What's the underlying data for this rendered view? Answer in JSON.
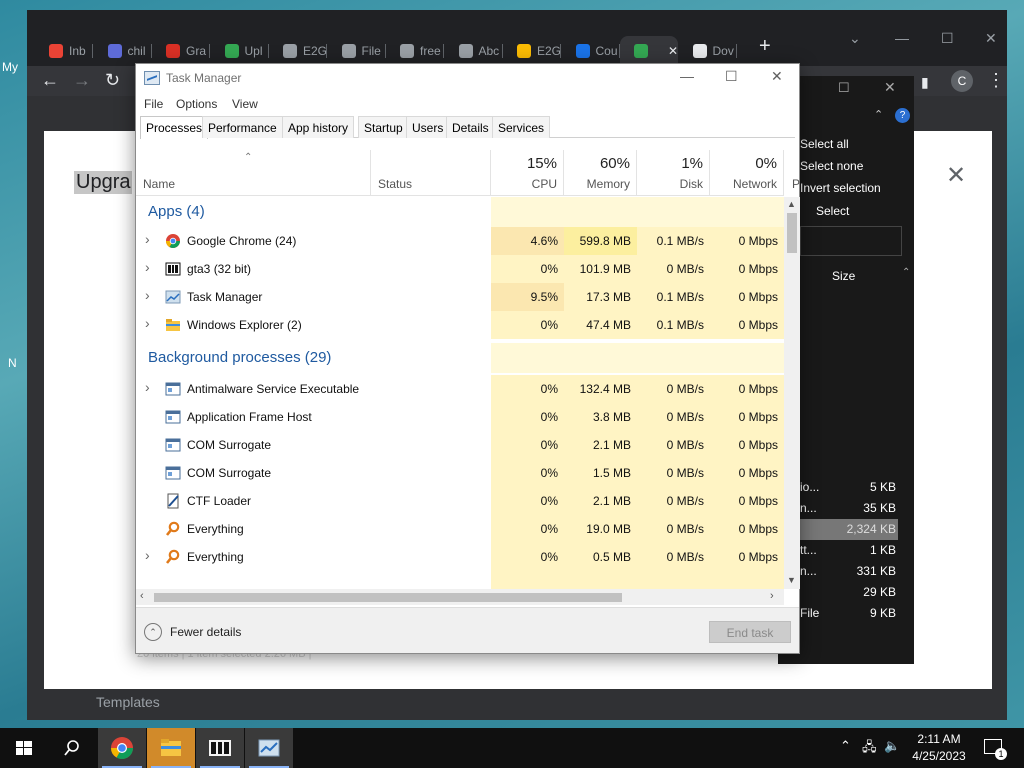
{
  "desktop": {
    "frag_top": "My",
    "frag_mid": "N"
  },
  "browser": {
    "tabs": [
      {
        "label": "Inb",
        "icon": "gmail-icon",
        "color": "#ea4335"
      },
      {
        "label": "chil",
        "icon": "account-icon",
        "color": "#5e6bd8"
      },
      {
        "label": "Gra",
        "icon": "grammarly-icon",
        "color": "#d93025"
      },
      {
        "label": "Upl",
        "icon": "cloud-icon",
        "color": "#34a853"
      },
      {
        "label": "E2G",
        "icon": "globe-icon",
        "color": "#9aa0a6"
      },
      {
        "label": "File",
        "icon": "globe-icon",
        "color": "#9aa0a6"
      },
      {
        "label": "free",
        "icon": "globe-icon",
        "color": "#9aa0a6"
      },
      {
        "label": "Abc",
        "icon": "globe-icon",
        "color": "#9aa0a6"
      },
      {
        "label": "E2G",
        "icon": "drive-icon",
        "color": "#fbbc04"
      },
      {
        "label": "Cou",
        "icon": "c-icon",
        "color": "#1a73e8"
      },
      {
        "label": "",
        "icon": "active-tab-icon",
        "color": "#34a853"
      },
      {
        "label": "Dov",
        "icon": "download-icon",
        "color": "#e8eaed"
      }
    ],
    "new_tab": "+",
    "avatar_letter": "C"
  },
  "modal": {
    "title": "Upgra",
    "close": "✕"
  },
  "templates_label": "Templates",
  "explorer": {
    "select_all": "Select all",
    "select_none": "Select none",
    "invert_selection": "Invert selection",
    "select_group": "Select",
    "size_header": "Size",
    "rows": [
      {
        "name": "io...",
        "size": "5 KB",
        "selected": false
      },
      {
        "name": "n...",
        "size": "35 KB",
        "selected": false
      },
      {
        "name": "",
        "size": "2,324 KB",
        "selected": true
      },
      {
        "name": "tt...",
        "size": "1 KB",
        "selected": false
      },
      {
        "name": "n...",
        "size": "331 KB",
        "selected": false
      },
      {
        "name": "",
        "size": "29 KB",
        "selected": false
      },
      {
        "name": "File",
        "size": "9 KB",
        "selected": false
      }
    ],
    "status": "20 items  |  1 item selected  2.26 MB  |"
  },
  "taskmanager": {
    "title": "Task Manager",
    "menu": [
      "File",
      "Options",
      "View"
    ],
    "tabs": [
      "Processes",
      "Performance",
      "App history",
      "Startup",
      "Users",
      "Details",
      "Services"
    ],
    "active_tab": "Processes",
    "columns": {
      "name": "Name",
      "status": "Status",
      "cpu_pct": "15%",
      "cpu": "CPU",
      "mem_pct": "60%",
      "mem": "Memory",
      "disk_pct": "1%",
      "disk": "Disk",
      "net_pct": "0%",
      "net": "Network",
      "next": "P"
    },
    "groups": {
      "apps": "Apps (4)",
      "background": "Background processes (29)"
    },
    "apps": [
      {
        "name": "Google Chrome (24)",
        "icon": "chrome-icon",
        "expand": true,
        "cpu": "4.6%",
        "mem": "599.8 MB",
        "disk": "0.1 MB/s",
        "net": "0 Mbps"
      },
      {
        "name": "gta3 (32 bit)",
        "icon": "gta-icon",
        "expand": true,
        "cpu": "0%",
        "mem": "101.9 MB",
        "disk": "0 MB/s",
        "net": "0 Mbps"
      },
      {
        "name": "Task Manager",
        "icon": "taskmanager-icon",
        "expand": true,
        "cpu": "9.5%",
        "mem": "17.3 MB",
        "disk": "0.1 MB/s",
        "net": "0 Mbps"
      },
      {
        "name": "Windows Explorer (2)",
        "icon": "folder-icon",
        "expand": true,
        "cpu": "0%",
        "mem": "47.4 MB",
        "disk": "0.1 MB/s",
        "net": "0 Mbps"
      }
    ],
    "background": [
      {
        "name": "Antimalware Service Executable",
        "icon": "service-icon",
        "expand": true,
        "cpu": "0%",
        "mem": "132.4 MB",
        "disk": "0 MB/s",
        "net": "0 Mbps"
      },
      {
        "name": "Application Frame Host",
        "icon": "service-icon",
        "expand": false,
        "cpu": "0%",
        "mem": "3.8 MB",
        "disk": "0 MB/s",
        "net": "0 Mbps"
      },
      {
        "name": "COM Surrogate",
        "icon": "service-icon",
        "expand": false,
        "cpu": "0%",
        "mem": "2.1 MB",
        "disk": "0 MB/s",
        "net": "0 Mbps"
      },
      {
        "name": "COM Surrogate",
        "icon": "service-icon",
        "expand": false,
        "cpu": "0%",
        "mem": "1.5 MB",
        "disk": "0 MB/s",
        "net": "0 Mbps"
      },
      {
        "name": "CTF Loader",
        "icon": "ctf-icon",
        "expand": false,
        "cpu": "0%",
        "mem": "2.1 MB",
        "disk": "0 MB/s",
        "net": "0 Mbps"
      },
      {
        "name": "Everything",
        "icon": "search-magnifier-icon",
        "expand": false,
        "cpu": "0%",
        "mem": "19.0 MB",
        "disk": "0 MB/s",
        "net": "0 Mbps"
      },
      {
        "name": "Everything",
        "icon": "search-magnifier-icon",
        "expand": true,
        "cpu": "0%",
        "mem": "0.5 MB",
        "disk": "0 MB/s",
        "net": "0 Mbps"
      }
    ],
    "fewer_details": "Fewer details",
    "end_task": "End task"
  },
  "taskbar": {
    "time": "2:11 AM",
    "date": "4/25/2023",
    "notif_count": "1"
  }
}
